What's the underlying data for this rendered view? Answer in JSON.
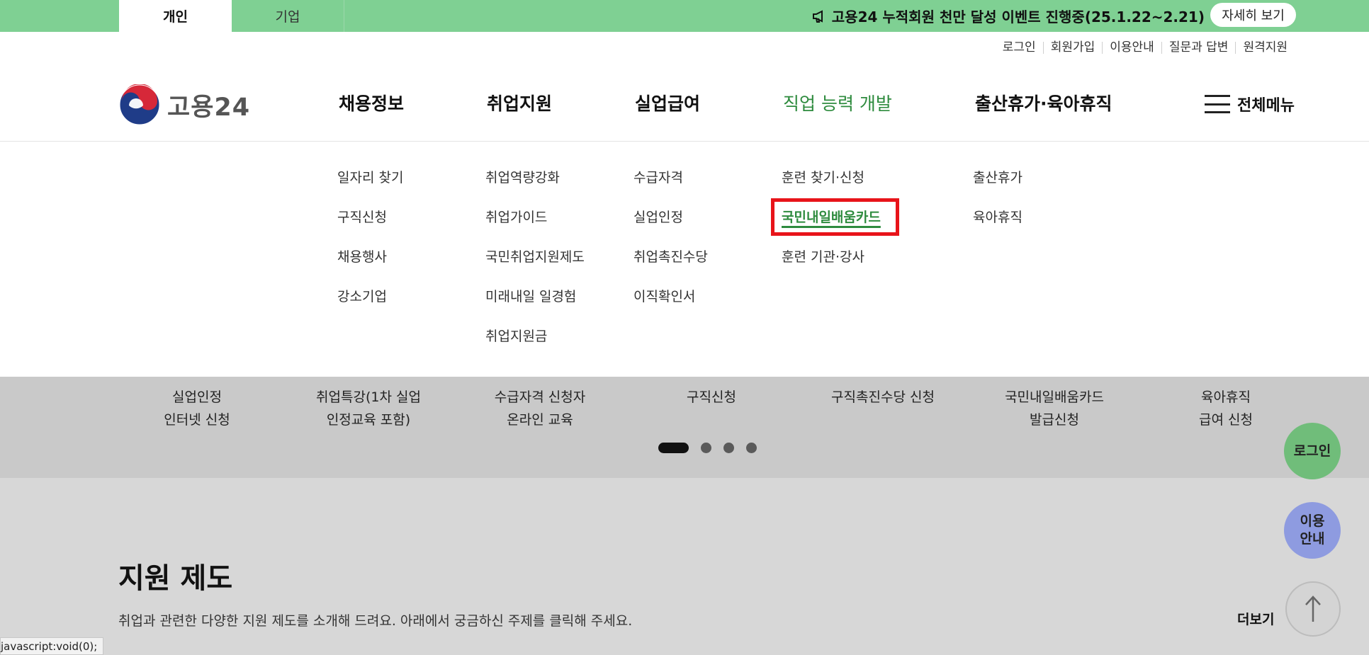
{
  "topbar": {
    "tabs": [
      {
        "label": "개인",
        "active": true
      },
      {
        "label": "기업",
        "active": false
      }
    ],
    "notice": "고용24 누적회원 천만 달성 이벤트 진행중(25.1.22~2.21)",
    "detail_button": "자세히 보기",
    "bar_color": "#7fd093"
  },
  "utility_links": [
    "로그인",
    "회원가입",
    "이용안내",
    "질문과 답변",
    "원격지원"
  ],
  "logo": {
    "text": "고용24"
  },
  "gnb": {
    "items": [
      "채용정보",
      "취업지원",
      "실업급여",
      "직업 능력 개발",
      "출산휴가·육아휴직"
    ],
    "active_item": "직업 능력 개발",
    "all_menu": "전체메뉴",
    "accent_color": "#2e8b3e"
  },
  "submenu": {
    "col1": [
      "일자리 찾기",
      "구직신청",
      "채용행사",
      "강소기업"
    ],
    "col2": [
      "취업역량강화",
      "취업가이드",
      "국민취업지원제도",
      "미래내일 일경험",
      "취업지원금"
    ],
    "col3": [
      "수급자격",
      "실업인정",
      "취업촉진수당",
      "이직확인서"
    ],
    "col4": [
      "훈련 찾기·신청",
      "국민내일배움카드",
      "훈련 기관·강사"
    ],
    "col5": [
      "출산휴가",
      "육아휴직"
    ],
    "highlighted": "국민내일배움카드"
  },
  "quick_links": [
    [
      "실업인정",
      "인터넷 신청"
    ],
    [
      "취업특강(1차 실업",
      "인정교육 포함)"
    ],
    [
      "수급자격 신청자",
      "온라인 교육"
    ],
    [
      "구직신청",
      ""
    ],
    [
      "구직촉진수당 신청",
      ""
    ],
    [
      "국민내일배움카드",
      "발급신청"
    ],
    [
      "육아휴직",
      "급여 신청"
    ]
  ],
  "carousel": {
    "pages": 4,
    "current": 1
  },
  "section": {
    "title": "지원 제도",
    "description": "취업과 관련한 다양한 지원 제도를 소개해 드려요. 아래에서 궁금하신 주제를 클릭해 주세요.",
    "more": "더보기"
  },
  "floating": {
    "login": "로그인",
    "guide_line1": "이용",
    "guide_line2": "안내",
    "top_icon": "arrow-up-icon"
  },
  "status_url": "javascript:void(0);"
}
